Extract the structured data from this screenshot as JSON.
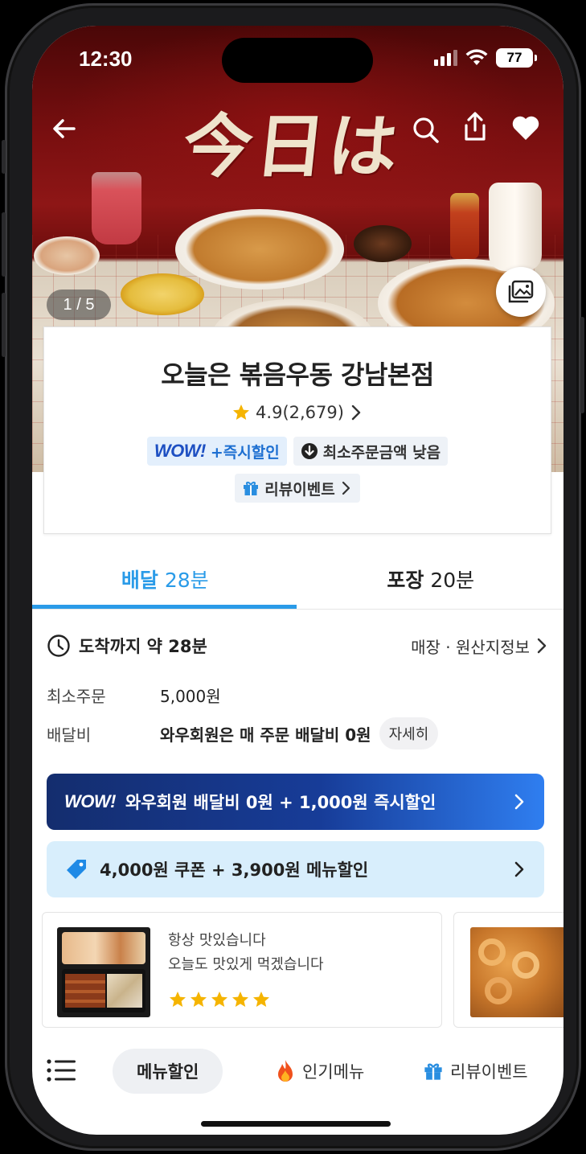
{
  "status_bar": {
    "time": "12:30",
    "battery": "77"
  },
  "hero": {
    "title_art": "今日は",
    "counter": "1 / 5"
  },
  "store": {
    "name": "오늘은 볶음우동 강남본점",
    "rating": "4.9(2,679)",
    "badges": {
      "wow_logo": "WOW!",
      "wow_text": "+즉시할인",
      "min_order_low": "최소주문금액 낮음",
      "review_event": "리뷰이벤트"
    }
  },
  "tabs": [
    {
      "label": "배달",
      "time": "28분"
    },
    {
      "label": "포장",
      "time": "20분"
    }
  ],
  "delivery": {
    "eta": "도착까지 약 28분",
    "store_info_link": "매장 · 원산지정보",
    "min_order_label": "최소주문",
    "min_order_value": "5,000원",
    "fee_label": "배달비",
    "fee_value": "와우회원은 매 주문 배달비 0원",
    "detail_chip": "자세히"
  },
  "banners": {
    "wow_logo": "WOW!",
    "wow_text": "와우회원 배달비 0원 + 1,000원 즉시할인",
    "coupon_text": "4,000원 쿠폰 + 3,900원 메뉴할인"
  },
  "reviews": [
    {
      "line1": "항상 맛있습니다",
      "line2": "오늘도 맛있게 먹겠습니다",
      "stars": 5
    }
  ],
  "bottom_nav": {
    "menu_discount": "메뉴할인",
    "popular_menu": "인기메뉴",
    "review_event": "리뷰이벤트"
  },
  "colors": {
    "accent": "#2a9be8",
    "wow_blue": "#1d4fc2",
    "star": "#f5b400",
    "coupon_bg": "#d8eefc"
  },
  "icons": [
    "back-arrow-icon",
    "search-icon",
    "share-icon",
    "heart-icon",
    "gallery-icon",
    "star-icon",
    "chevron-right-icon",
    "down-circle-icon",
    "gift-icon",
    "clock-icon",
    "tag-icon",
    "list-icon",
    "fire-icon"
  ]
}
